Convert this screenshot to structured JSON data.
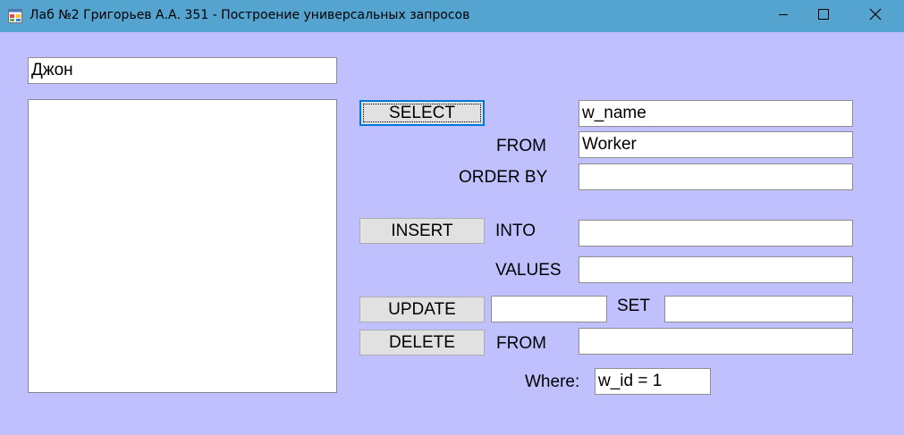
{
  "window": {
    "title": "Лаб №2 Григорьев А.А. 351 - Построение универсальных запросов",
    "icon": "app-form-icon",
    "controls": [
      "minimize-icon",
      "maximize-icon",
      "close-icon"
    ]
  },
  "search": {
    "value": "Джон"
  },
  "select_query": {
    "button_label": "SELECT",
    "fields_value": "w_name",
    "from_label": "FROM",
    "from_value": "Worker",
    "order_label": "ORDER BY",
    "order_value": ""
  },
  "insert_query": {
    "button_label": "INSERT",
    "into_label": "INTO",
    "into_value": "",
    "values_label": "VALUES",
    "values_value": ""
  },
  "update_query": {
    "button_label": "UPDATE",
    "table_value": "",
    "set_label": "SET",
    "set_value": ""
  },
  "delete_query": {
    "button_label": "DELETE",
    "from_label": "FROM",
    "from_value": ""
  },
  "where": {
    "label": "Where:",
    "value": "w_id = 1"
  },
  "results": {
    "items": []
  },
  "colors": {
    "titlebar": "#55a4d0",
    "background": "#c0c0ff",
    "button_face": "#e1e1e1",
    "focus_border": "#0078d7"
  }
}
